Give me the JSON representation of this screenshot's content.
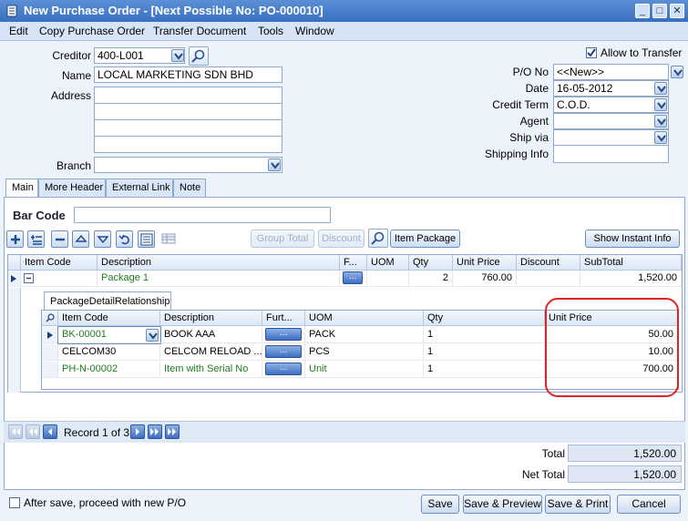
{
  "window": {
    "title": "New Purchase Order - [Next Possible No: PO-000010]"
  },
  "menu": [
    "Edit",
    "Copy Purchase Order",
    "Transfer Document",
    "Tools",
    "Window"
  ],
  "header": {
    "creditor_label": "Creditor",
    "creditor_value": "400-L001",
    "name_label": "Name",
    "name_value": "LOCAL MARKETING SDN BHD",
    "address_label": "Address",
    "branch_label": "Branch",
    "allow_transfer_label": "Allow to Transfer",
    "allow_transfer_checked": true,
    "po_no_label": "P/O  No",
    "po_no_value": "<<New>>",
    "date_label": "Date",
    "date_value": "16-05-2012",
    "credit_term_label": "Credit Term",
    "credit_term_value": "C.O.D.",
    "agent_label": "Agent",
    "ship_via_label": "Ship via",
    "shipping_info_label": "Shipping Info"
  },
  "tabs": [
    "Main",
    "More Header",
    "External Link",
    "Note"
  ],
  "barcode_label": "Bar Code",
  "toolbar": {
    "group_total": "Group Total",
    "discount": "Discount",
    "item_package": "Item Package",
    "show_instant_info": "Show Instant Info"
  },
  "grid": {
    "columns": [
      "Item Code",
      "Description",
      "F...",
      "UOM",
      "Qty",
      "Unit Price",
      "Discount",
      "SubTotal"
    ],
    "row": {
      "item_code": "",
      "description": "Package 1",
      "qty": "2",
      "unit_price": "760.00",
      "subtotal": "1,520.00"
    }
  },
  "detail": {
    "tab_label": "PackageDetailRelationship",
    "columns": [
      "Item Code",
      "Description",
      "Furt...",
      "UOM",
      "Qty",
      "Unit Price"
    ],
    "rows": [
      {
        "item_code": "BK-00001",
        "description": "BOOK AAA",
        "uom": "PACK",
        "qty": "1",
        "unit_price": "50.00"
      },
      {
        "item_code": "CELCOM30",
        "description": "CELCOM RELOAD ...",
        "uom": "PCS",
        "qty": "1",
        "unit_price": "10.00"
      },
      {
        "item_code": "PH-N-00002",
        "description": "Item with Serial No",
        "uom": "Unit",
        "qty": "1",
        "unit_price": "700.00"
      }
    ],
    "dots": "..."
  },
  "navigator": {
    "record_text": "Record 1 of 3"
  },
  "totals": {
    "total_label": "Total",
    "total_value": "1,520.00",
    "net_total_label": "Net Total",
    "net_total_value": "1,520.00"
  },
  "footer": {
    "after_save_label": "After save, proceed with new P/O",
    "save": "Save",
    "save_preview": "Save & Preview",
    "save_print": "Save & Print",
    "cancel": "Cancel"
  },
  "colors": {
    "title_bar": "#3a6fc0",
    "highlight": "#e32222",
    "green_text": "#217a21"
  }
}
